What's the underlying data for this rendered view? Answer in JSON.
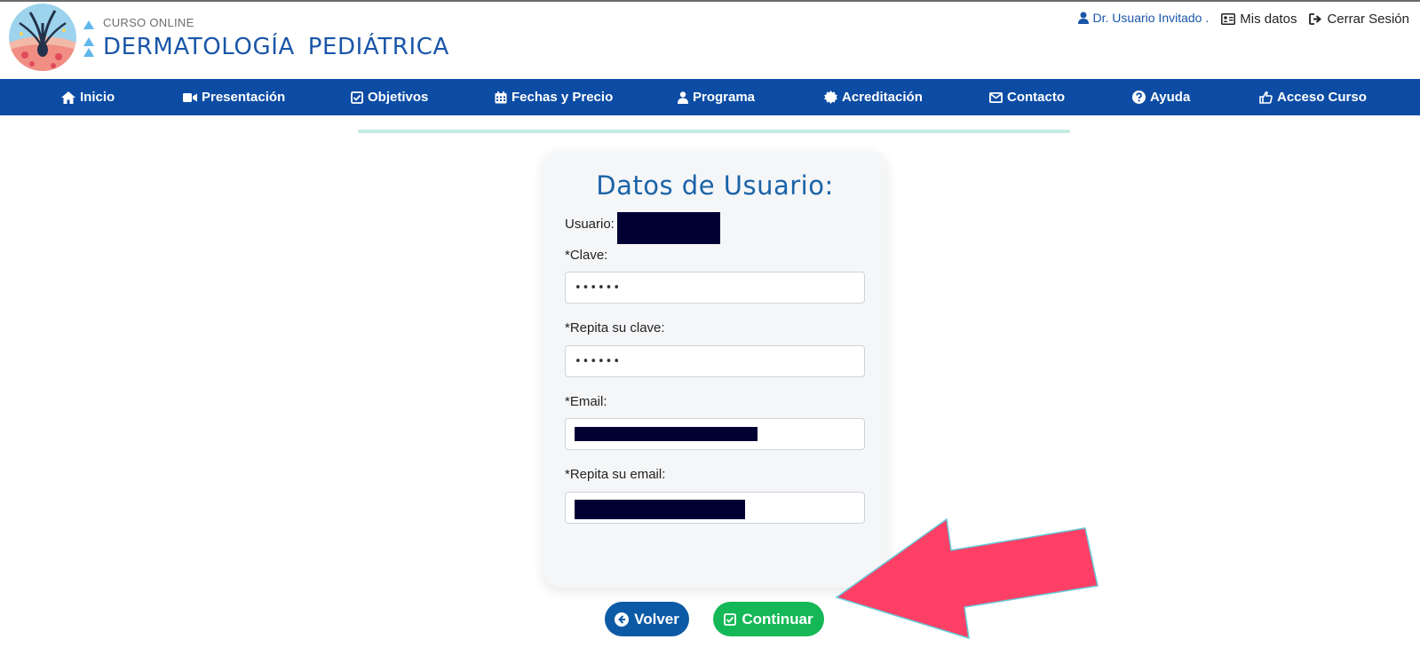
{
  "header": {
    "brand_small": "CURSO ONLINE",
    "brand_big": "DERMATOLOGÍA  PEDIÁTRICA",
    "user_name": "Dr. Usuario Invitado .",
    "my_data": "Mis datos",
    "logout": "Cerrar Sesión"
  },
  "nav": {
    "items": [
      {
        "label": "Inicio",
        "icon": "home-icon"
      },
      {
        "label": "Presentación",
        "icon": "video-camera-icon"
      },
      {
        "label": "Objetivos",
        "icon": "checkbox-icon"
      },
      {
        "label": "Fechas y Precio",
        "icon": "calendar-icon"
      },
      {
        "label": "Programa",
        "icon": "user-icon"
      },
      {
        "label": "Acreditación",
        "icon": "badge-icon"
      },
      {
        "label": "Contacto",
        "icon": "envelope-icon"
      },
      {
        "label": "Ayuda",
        "icon": "question-circle-icon"
      },
      {
        "label": "Acceso Curso",
        "icon": "hand-pointer-icon"
      }
    ]
  },
  "form": {
    "title": "Datos de Usuario:",
    "user_label": "Usuario:",
    "password_label": "*Clave:",
    "password_value": "••••••",
    "password_repeat_label": "*Repita su clave:",
    "password_repeat_value": "••••••",
    "email_label": "*Email:",
    "email_repeat_label": "*Repita su email:"
  },
  "buttons": {
    "back": "Volver",
    "continue": "Continuar"
  },
  "colors": {
    "nav_bg": "#0c4ca4",
    "brand_blue": "#1a56a8",
    "continue_green": "#15b857",
    "back_blue": "#0c5aa6",
    "arrow_pink": "#fe3f66"
  }
}
